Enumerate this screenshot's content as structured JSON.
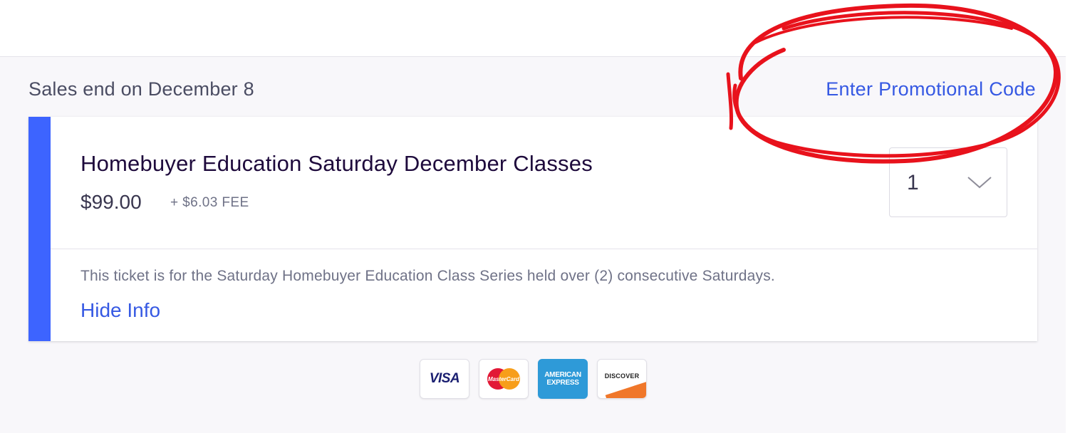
{
  "sales": {
    "end_text": "Sales end on December 8",
    "promo_link": "Enter Promotional Code"
  },
  "ticket": {
    "name": "Homebuyer Education Saturday December Classes",
    "price": "$99.00",
    "fee": "+ $6.03 FEE",
    "quantity": "1",
    "description": "This ticket is for the Saturday Homebuyer Education Class Series held over (2) consecutive Saturdays.",
    "hide_info": "Hide Info"
  },
  "payment_methods": {
    "visa": "VISA",
    "mastercard": "MasterCard",
    "amex_line1": "AMERICAN",
    "amex_line2": "EXPRESS",
    "discover": "DISCOVER"
  },
  "colors": {
    "accent": "#3d64ff",
    "link": "#3659e3",
    "annotation": "#e8121c"
  },
  "icons": {
    "quantity_select": "chevron-down-icon"
  }
}
